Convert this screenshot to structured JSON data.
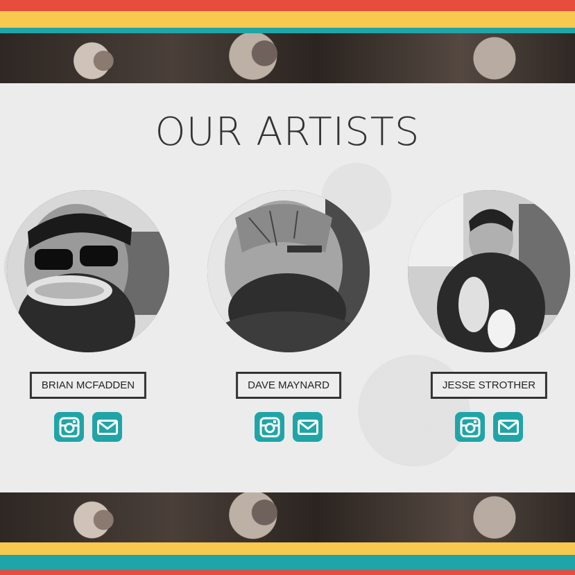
{
  "section_title": "OUR ARTISTS",
  "colors": {
    "stripe_red": "#e84c3d",
    "stripe_yellow": "#f8c94e",
    "stripe_teal": "#1fa5a8",
    "icon_accent": "#1fa5a8",
    "panel_bg": "#ececec",
    "text_dark": "#333333"
  },
  "artists": [
    {
      "name": "BRIAN MCFADDEN",
      "links": [
        "instagram-icon",
        "mail-icon"
      ]
    },
    {
      "name": "DAVE MAYNARD",
      "links": [
        "instagram-icon",
        "mail-icon"
      ]
    },
    {
      "name": "JESSE STROTHER",
      "links": [
        "instagram-icon",
        "mail-icon"
      ]
    }
  ]
}
